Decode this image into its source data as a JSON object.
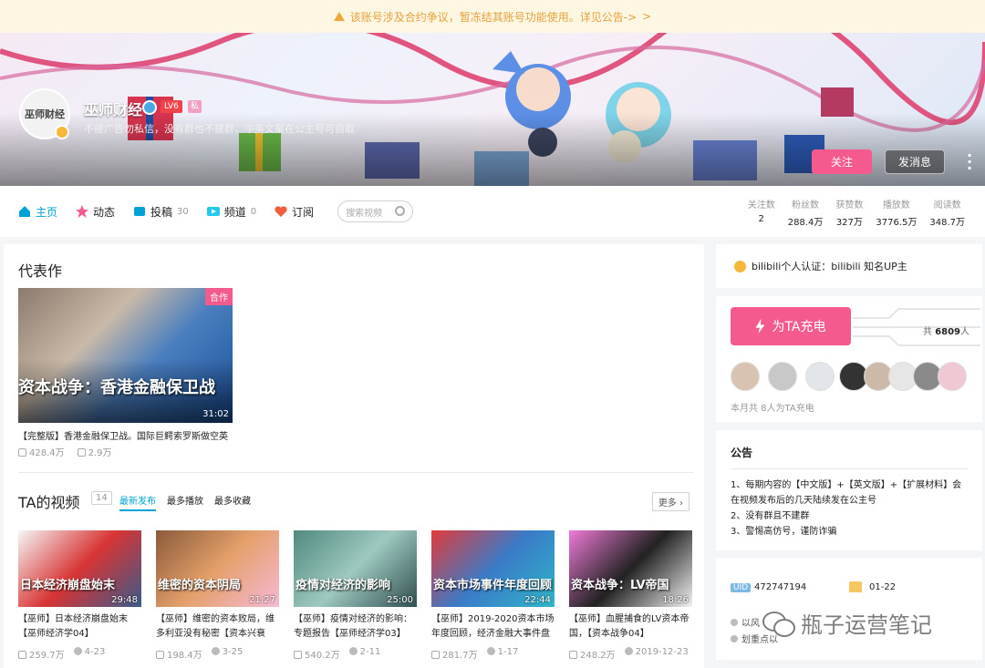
{
  "notice": {
    "text": "该账号涉及合约争议，暂冻结其账号功能使用。详见公告->",
    "arrow": ">"
  },
  "profile": {
    "avatar_text": "巫师财经",
    "name": "巫师财经",
    "level": "LV6",
    "level_extra": "私",
    "sign": "不接广告勿私信，没有群也不建群，中英文案在公主号可自取",
    "follow_label": "关注",
    "message_label": "发消息"
  },
  "nav": {
    "items": [
      {
        "label": "主页",
        "count": "",
        "icon": "home-icon",
        "color": "#00a1d6"
      },
      {
        "label": "动态",
        "count": "",
        "icon": "dynamic-icon",
        "color": "#f45a8d"
      },
      {
        "label": "投稿",
        "count": "30",
        "icon": "upload-icon",
        "color": "#00a1d6"
      },
      {
        "label": "频道",
        "count": "0",
        "icon": "channel-icon",
        "color": "#23c9ed"
      },
      {
        "label": "订阅",
        "count": "",
        "icon": "heart-icon",
        "color": "#f25d3f"
      }
    ],
    "search_placeholder": "搜索视频"
  },
  "stats": [
    {
      "label": "关注数",
      "value": "2"
    },
    {
      "label": "粉丝数",
      "value": "288.4万"
    },
    {
      "label": "获赞数",
      "value": "327万"
    },
    {
      "label": "播放数",
      "value": "3776.5万"
    },
    {
      "label": "阅读数",
      "value": "348.7万"
    }
  ],
  "representative": {
    "section_title": "代表作",
    "tag": "合作",
    "cover_text": "资本战争：香港金融保卫战",
    "duration": "31:02",
    "title": "【完整版】香港金融保卫战。国际巨鳄索罗斯做空英",
    "plays": "428.4万",
    "danmaku": "2.9万"
  },
  "ta_videos": {
    "title": "TA的视频",
    "count": "14",
    "tabs": [
      "最新发布",
      "最多播放",
      "最多收藏"
    ],
    "more_label": "更多",
    "items": [
      {
        "cover_text": "日本经济崩盘始末",
        "duration": "29:48",
        "title": "【巫师】日本经济崩盘始末【巫师经济学04】",
        "plays": "259.7万",
        "date": "4-23",
        "colors": [
          "#f6f6f6",
          "#d83434",
          "#3a5b8a"
        ]
      },
      {
        "cover_text": "维密的资本阴局",
        "duration": "21:27",
        "title": "【巫师】维密的资本败局，维多利亚没有秘密【资本兴衰",
        "plays": "198.4万",
        "date": "3-25",
        "colors": [
          "#8a5a3a",
          "#e4a06a",
          "#f6b8d6"
        ]
      },
      {
        "cover_text": "疫情对经济的影响",
        "duration": "25:00",
        "title": "【巫师】疫情对经济的影响：专题报告【巫师经济学03】",
        "plays": "540.2万",
        "date": "2-11",
        "colors": [
          "#4f8a7e",
          "#9ec8c0",
          "#2f4f4f"
        ]
      },
      {
        "cover_text": "资本市场事件年度回顾",
        "duration": "22:44",
        "title": "【巫师】2019-2020资本市场年度回顾，经济金融大事件盘",
        "plays": "281.7万",
        "date": "1-17",
        "colors": [
          "#e23a3a",
          "#3a7bc8",
          "#2fb6c8"
        ]
      },
      {
        "cover_text": "资本战争：LV帝国",
        "duration": "18:26",
        "title": "【巫师】血腥捕食的LV资本帝国，【资本战争04】",
        "plays": "248.2万",
        "date": "2019-12-23",
        "colors": [
          "#f07ad8",
          "#222222",
          "#f2f2f2"
        ]
      }
    ]
  },
  "auth": {
    "text": "bilibili个人认证：bilibili 知名UP主"
  },
  "charge": {
    "button_label": "为TA充电",
    "total_prefix": "共",
    "total_value": "6809",
    "total_suffix": "人",
    "note": "本月共 8人为TA充电",
    "fans": [
      "#d9c3b0",
      "#c8c8c8",
      "#e2e6ea",
      "#333333",
      "#cdb9a8",
      "#e6e6e6",
      "#8a8a8a",
      "#f0c8d4"
    ]
  },
  "announcement": {
    "title": "公告",
    "lines": [
      "1、每期内容的【中文版】+【英文版】+【扩展材料】会在视频发布后的几天陆续发在公主号",
      "2、没有群且不建群",
      "3、警惕高仿号，谨防诈骗"
    ]
  },
  "info": {
    "uid_label": "UID",
    "uid": "472747194",
    "birthday": "01-22",
    "tags": [
      "以风",
      "划重点以"
    ]
  },
  "watermark": {
    "text": "瓶子运营笔记"
  }
}
